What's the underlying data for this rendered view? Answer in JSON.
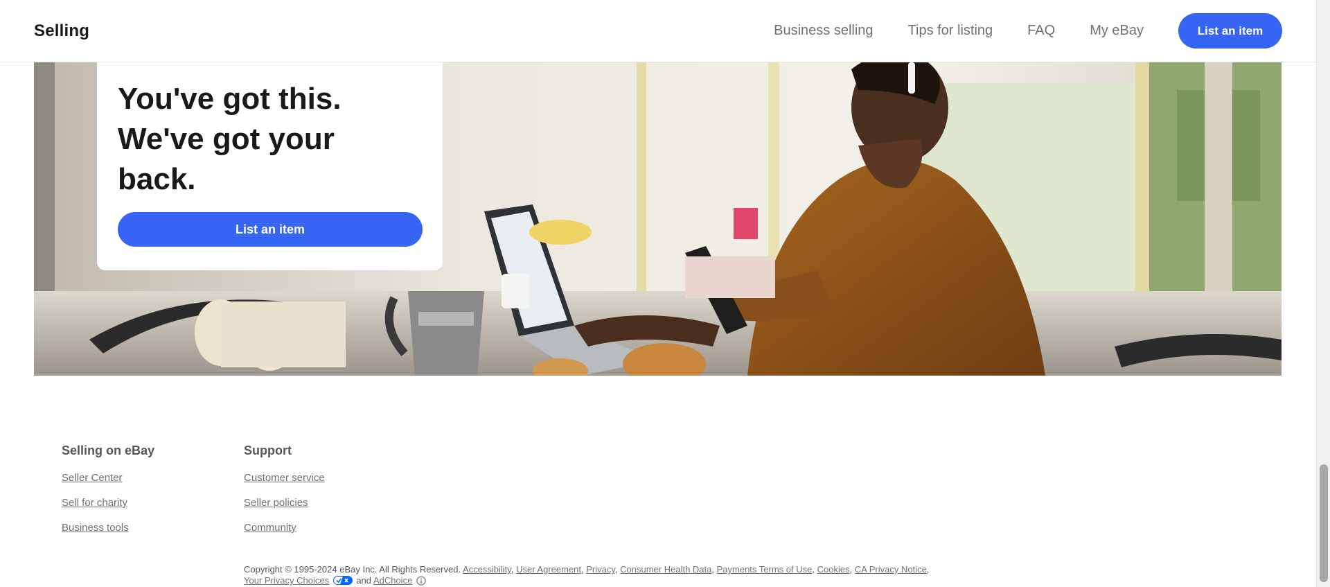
{
  "header": {
    "brand": "Selling",
    "nav": [
      "Business selling",
      "Tips for listing",
      "FAQ",
      "My eBay"
    ],
    "cta": "List an item"
  },
  "hero": {
    "title_line1": "You've got this.",
    "title_line2": "We've got your",
    "title_line3": "back.",
    "cta": "List an item"
  },
  "footer": {
    "selling": {
      "heading": "Selling on eBay",
      "links": [
        "Seller Center",
        "Sell for charity",
        "Business tools"
      ]
    },
    "support": {
      "heading": "Support",
      "links": [
        "Customer service",
        "Seller policies",
        "Community"
      ]
    },
    "legal": {
      "copyright": "Copyright © 1995-2024 eBay Inc. All Rights Reserved.",
      "links": [
        "Accessibility",
        "User Agreement",
        "Privacy",
        "Consumer Health Data",
        "Payments Terms of Use",
        "Cookies",
        "CA Privacy Notice"
      ],
      "privacy_choices": "Your Privacy Choices",
      "and": "and",
      "adchoice": "AdChoice"
    }
  },
  "colors": {
    "accent": "#3665f3",
    "link": "#707070"
  },
  "icons": {
    "privacy_choices": "privacy-choices-toggle-icon",
    "adchoice": "info-icon"
  }
}
